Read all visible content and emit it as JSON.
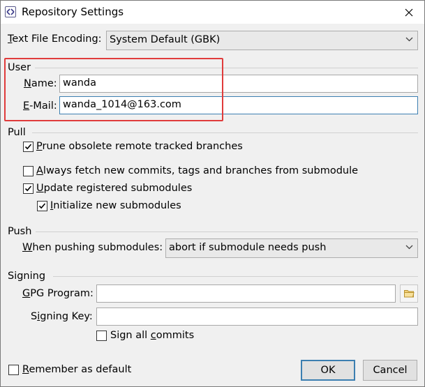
{
  "window": {
    "title": "Repository Settings",
    "app_icon": "diamond-icon",
    "close_icon": "close-icon"
  },
  "encoding": {
    "label": "Text File Encoding:",
    "label_mnemonic": "T",
    "label_rest": "ext File Encoding:",
    "value": "System Default (GBK)"
  },
  "user": {
    "section": "User",
    "name_label": "Name:",
    "name_mnemonic": "N",
    "name_rest": "ame:",
    "name_value": "wanda",
    "email_label": "E-Mail:",
    "email_mnemonic": "E",
    "email_rest": "-Mail:",
    "email_value": "wanda_1014@163.com"
  },
  "pull": {
    "section": "Pull",
    "options": [
      {
        "label": "Prune obsolete remote tracked branches",
        "mnemonic": "P",
        "rest": "rune obsolete remote tracked branches",
        "checked": true
      },
      {
        "label": "Always fetch new commits, tags and branches from submodule",
        "mnemonic": "A",
        "rest": "lways fetch new commits, tags and branches from submodule",
        "checked": false
      },
      {
        "label": "Update registered submodules",
        "mnemonic": "U",
        "rest": "pdate registered submodules",
        "checked": true
      },
      {
        "label": "Initialize new submodules",
        "mnemonic": "I",
        "rest": "nitialize new submodules",
        "checked": true
      }
    ]
  },
  "push": {
    "section": "Push",
    "label": "When pushing submodules:",
    "mnemonic": "W",
    "rest": "hen pushing submodules:",
    "value": "abort if submodule needs push"
  },
  "signing": {
    "section": "Signing",
    "gpg_label": "GPG Program:",
    "gpg_mnemonic": "G",
    "gpg_rest": "PG Program:",
    "gpg_value": "",
    "key_label": "Signing Key:",
    "key_pre": "S",
    "key_mnemonic": "i",
    "key_rest": "gning Key:",
    "key_value": "",
    "sign_all": {
      "label": "Sign all commits",
      "pre": "Sign all ",
      "mnemonic": "c",
      "rest": "ommits",
      "checked": false
    },
    "browse_icon": "folder-icon"
  },
  "footer": {
    "remember": {
      "label": "Remember as default",
      "mnemonic": "R",
      "rest": "emember as default",
      "checked": false
    },
    "ok_label": "OK",
    "cancel_label": "Cancel"
  },
  "colors": {
    "highlight": "#e03b3b",
    "focus": "#3c7fb1",
    "dialog_bg": "#f0f0f0"
  }
}
